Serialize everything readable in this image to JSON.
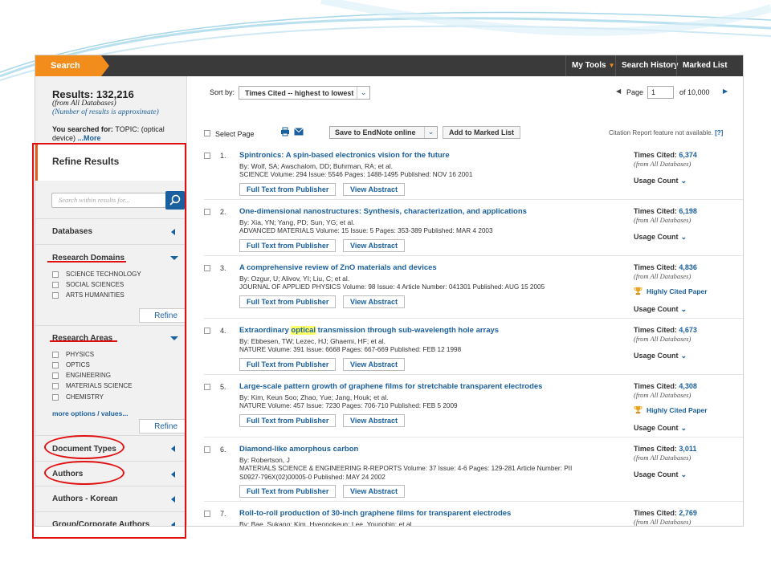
{
  "topbar": {
    "search_tab": "Search",
    "my_tools": "My Tools",
    "search_history": "Search History",
    "marked_list": "Marked List"
  },
  "summary": {
    "results_label": "Results: 132,216",
    "from": "(from All Databases)",
    "approx_link": "(Number of results is approximate)",
    "searched_prefix": "You searched for: ",
    "searched_topic": "TOPIC: (optical",
    "searched_device": "device)",
    "more": "...More"
  },
  "refine": {
    "header": "Refine Results",
    "search_placeholder": "Search within results for...",
    "databases": "Databases",
    "research_domains": {
      "title": "Research Domains",
      "items": [
        "SCIENCE TECHNOLOGY",
        "SOCIAL SCIENCES",
        "ARTS HUMANITIES"
      ],
      "refine_button": "Refine"
    },
    "research_areas": {
      "title": "Research Areas",
      "items": [
        "PHYSICS",
        "OPTICS",
        "ENGINEERING",
        "MATERIALS SCIENCE",
        "CHEMISTRY"
      ],
      "more_options": "more options / values...",
      "refine_button": "Refine"
    },
    "document_types": "Document Types",
    "authors": "Authors",
    "authors_korean": "Authors - Korean",
    "group_authors": "Group/Corporate Authors"
  },
  "sort": {
    "label": "Sort by:",
    "selected": "Times Cited -- highest to lowest"
  },
  "pagination": {
    "page_label": "Page",
    "page_value": "1",
    "of_label": "of 10,000"
  },
  "toolbar": {
    "select_page": "Select Page",
    "save_endnote": "Save to EndNote online",
    "add_marked": "Add to Marked List",
    "citation_note": "Citation Report feature not available.",
    "help": "[?]"
  },
  "results": [
    {
      "num": "1.",
      "title": "Spintronics: A spin-based electronics vision for the future",
      "by": "By: Wolf, SA; Awschalom, DD; Buhrman, RA; et al.",
      "source": "SCIENCE  Volume: 294   Issue: 5546   Pages: 1488-1495   Published: NOV 16 2001",
      "times_cited_label": "Times Cited: ",
      "times_cited": "6,374",
      "from": "(from All Databases)",
      "usage": "Usage Count"
    },
    {
      "num": "2.",
      "title": "One-dimensional nanostructures: Synthesis, characterization, and applications",
      "by": "By: Xia, YN; Yang, PD; Sun, YG; et al.",
      "source": "ADVANCED MATERIALS  Volume: 15   Issue: 5   Pages: 353-389   Published: MAR 4 2003",
      "times_cited_label": "Times Cited: ",
      "times_cited": "6,198",
      "from": "(from All Databases)",
      "usage": "Usage Count"
    },
    {
      "num": "3.",
      "title": "A comprehensive review of ZnO materials and devices",
      "by": "By: Ozgur, U; Alivov, YI; Liu, C; et al.",
      "source": "JOURNAL OF APPLIED PHYSICS  Volume: 98   Issue: 4      Article Number: 041301   Published: AUG 15 2005",
      "times_cited_label": "Times Cited: ",
      "times_cited": "4,836",
      "from": "(from All Databases)",
      "highly_cited": "Highly Cited Paper",
      "usage": "Usage Count"
    },
    {
      "num": "4.",
      "title_pre": "Extraordinary ",
      "title_hl": "optical",
      "title_post": " transmission through sub-wavelength hole arrays",
      "by": "By: Ebbesen, TW; Lezec, HJ; Ghaemi, HF; et al.",
      "source": "NATURE  Volume: 391   Issue: 6668   Pages: 667-669   Published: FEB 12 1998",
      "times_cited_label": "Times Cited: ",
      "times_cited": "4,673",
      "from": "(from All Databases)",
      "usage": "Usage Count"
    },
    {
      "num": "5.",
      "title": "Large-scale pattern growth of graphene films for stretchable transparent electrodes",
      "by": "By: Kim, Keun Soo; Zhao, Yue; Jang, Houk; et al.",
      "source": "NATURE  Volume: 457   Issue: 7230   Pages: 706-710   Published: FEB 5 2009",
      "times_cited_label": "Times Cited: ",
      "times_cited": "4,308",
      "from": "(from All Databases)",
      "highly_cited": "Highly Cited Paper",
      "usage": "Usage Count"
    },
    {
      "num": "6.",
      "title": "Diamond-like amorphous carbon",
      "by": "By: Robertson, J",
      "source": "MATERIALS SCIENCE & ENGINEERING R-REPORTS  Volume: 37   Issue: 4-6   Pages: 129-281   Article Number: PII",
      "source2": "S0927-796X(02)00005-0   Published: MAY 24 2002",
      "times_cited_label": "Times Cited: ",
      "times_cited": "3,011",
      "from": "(from All Databases)",
      "usage": "Usage Count"
    },
    {
      "num": "7.",
      "title": "Roll-to-roll production of 30-inch graphene films for transparent electrodes",
      "by": "By: Bae, Sukang; Kim, Hyeongkeun; Lee, Youngbin; et al.",
      "times_cited_label": "Times Cited: ",
      "times_cited": "2,769",
      "from": "(from All Databases)"
    }
  ],
  "result_buttons": {
    "full_text": "Full Text from Publisher",
    "view_abstract": "View Abstract"
  },
  "colors": {
    "accent_orange": "#f28d1c",
    "link_blue": "#1a5f9e",
    "annotation_red": "#e01010",
    "topbar_dark": "#3a3a3a"
  }
}
